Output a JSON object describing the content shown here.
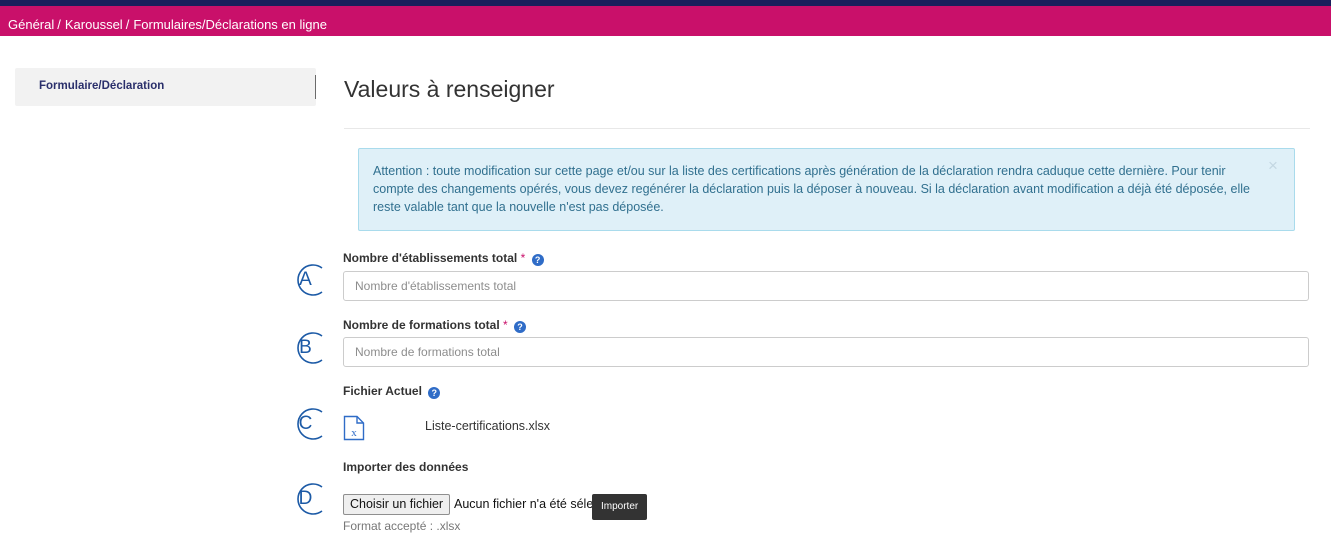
{
  "breadcrumb": {
    "items": [
      "Général",
      "Karoussel",
      "Formulaires/Déclarations en ligne"
    ],
    "separator": "/"
  },
  "sidebar": {
    "items": [
      {
        "label": "Formulaire/Déclaration"
      }
    ]
  },
  "main": {
    "title": "Valeurs à renseigner",
    "alert": {
      "text": "Attention : toute modification sur cette page et/ou sur la liste des certifications après génération de la déclaration rendra caduque cette dernière. Pour tenir compte des changements opérés, vous devez regénérer la déclaration puis la déposer à nouveau. Si la déclaration avant modification a déjà été déposée, elle reste valable tant que la nouvelle n'est pas déposée.",
      "close_symbol": "×"
    },
    "fields": {
      "etablissements": {
        "label": "Nombre d'établissements total",
        "required_mark": "*",
        "placeholder": "Nombre d'établissements total",
        "value": ""
      },
      "formations": {
        "label": "Nombre de formations total",
        "required_mark": "*",
        "placeholder": "Nombre de formations total",
        "value": ""
      }
    },
    "current_file": {
      "label": "Fichier Actuel",
      "filename": "Liste-certifications.xlsx",
      "icon": "excel-file-icon"
    },
    "import": {
      "label": "Importer des données",
      "choose_button": "Choisir un fichier",
      "no_file_text": "Aucun fichier n'a été sélectionné",
      "tooltip": "Importer",
      "format_note": "Format accepté : .xlsx"
    }
  },
  "help_icon_glyph": "?",
  "annotations": [
    "A",
    "B",
    "C",
    "D"
  ],
  "colors": {
    "header": "#c9106a",
    "header_top_border": "#1a1f5c",
    "accent": "#2f6cc7",
    "alert_bg": "#dff0f8",
    "annotation": "#1c5aa6"
  }
}
